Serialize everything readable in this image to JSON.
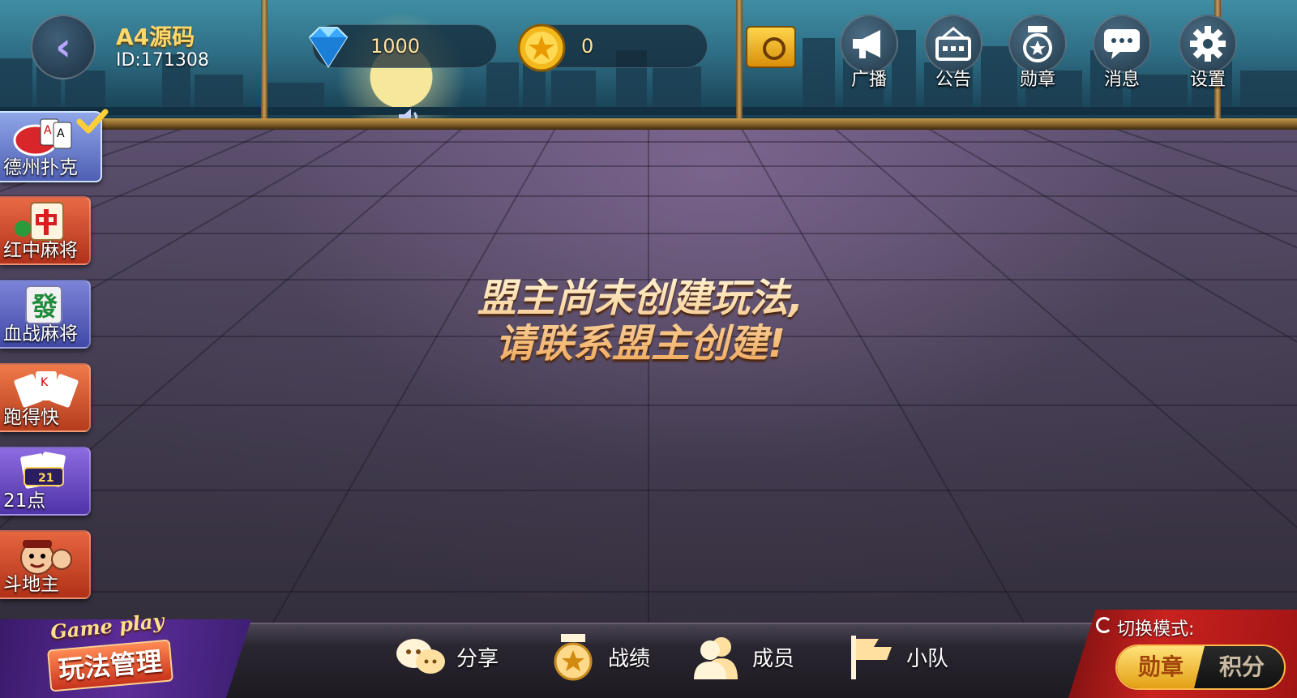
{
  "header": {
    "user_name": "A4源码",
    "user_id": "ID:171308",
    "diamonds": "1000",
    "coins": "0",
    "icons": [
      {
        "key": "broadcast",
        "label": "广播",
        "icon": "megaphone-icon"
      },
      {
        "key": "notice",
        "label": "公告",
        "icon": "noticeboard-icon"
      },
      {
        "key": "medal",
        "label": "勋章",
        "icon": "medal-icon"
      },
      {
        "key": "message",
        "label": "消息",
        "icon": "chat-bubble-icon"
      },
      {
        "key": "settings",
        "label": "设置",
        "icon": "gear-icon"
      }
    ]
  },
  "sidebar": {
    "games": [
      {
        "label": "德州扑克",
        "icon": "poker-chips-icon",
        "active": true,
        "color": "#6a7ec8"
      },
      {
        "label": "红中麻将",
        "icon": "mahjong-red-tile-icon",
        "active": false,
        "color": "#c8472d"
      },
      {
        "label": "血战麻将",
        "icon": "mahjong-green-tile-icon",
        "active": false,
        "color": "#5a62b8"
      },
      {
        "label": "跑得快",
        "icon": "playing-cards-icon",
        "active": false,
        "color": "#c9502a"
      },
      {
        "label": "21点",
        "icon": "blackjack-cards-icon",
        "active": false,
        "color": "#6a4fb4"
      },
      {
        "label": "斗地主",
        "icon": "landlord-face-icon",
        "active": false,
        "color": "#c84a2c"
      }
    ]
  },
  "main": {
    "message_line1": "盟主尚未创建玩法,",
    "message_line2": "请联系盟主创建!"
  },
  "footer": {
    "manage_en": "Game play",
    "manage_zh": "玩法管理",
    "buttons": [
      {
        "label": "分享",
        "icon": "wechat-share-icon"
      },
      {
        "label": "战绩",
        "icon": "record-medal-icon"
      },
      {
        "label": "成员",
        "icon": "members-icon"
      },
      {
        "label": "小队",
        "icon": "team-flag-icon"
      }
    ],
    "mode_title": "切换模式:",
    "mode_options": [
      "勋章",
      "积分"
    ],
    "mode_selected": "勋章"
  }
}
